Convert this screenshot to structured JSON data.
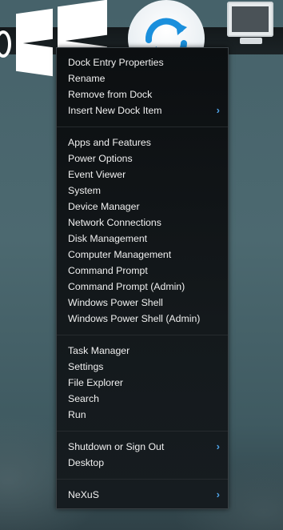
{
  "menu": {
    "groups": [
      [
        {
          "label": "Dock Entry Properties"
        },
        {
          "label": "Rename"
        },
        {
          "label": "Remove from Dock"
        },
        {
          "label": "Insert New Dock Item",
          "submenu": true
        }
      ],
      [
        {
          "label": "Apps and Features"
        },
        {
          "label": "Power Options"
        },
        {
          "label": "Event Viewer"
        },
        {
          "label": "System"
        },
        {
          "label": "Device Manager"
        },
        {
          "label": "Network Connections"
        },
        {
          "label": "Disk Management"
        },
        {
          "label": "Computer Management"
        },
        {
          "label": "Command Prompt"
        },
        {
          "label": "Command Prompt (Admin)"
        },
        {
          "label": "Windows Power Shell"
        },
        {
          "label": "Windows Power Shell (Admin)"
        }
      ],
      [
        {
          "label": "Task Manager"
        },
        {
          "label": "Settings"
        },
        {
          "label": "File Explorer"
        },
        {
          "label": "Search"
        },
        {
          "label": "Run"
        }
      ],
      [
        {
          "label": "Shutdown or Sign Out",
          "submenu": true
        },
        {
          "label": "Desktop"
        }
      ],
      [
        {
          "label": "NeXuS",
          "submenu": true
        }
      ]
    ]
  },
  "dock": {
    "icons": [
      "windows-logo-icon",
      "refresh-icon",
      "computer-icon"
    ]
  },
  "colors": {
    "menu_bg": "#0c0f11",
    "menu_text": "#f0f0f0",
    "submenu_arrow": "#4fa3e6",
    "refresh_blue": "#1a8fdc"
  }
}
